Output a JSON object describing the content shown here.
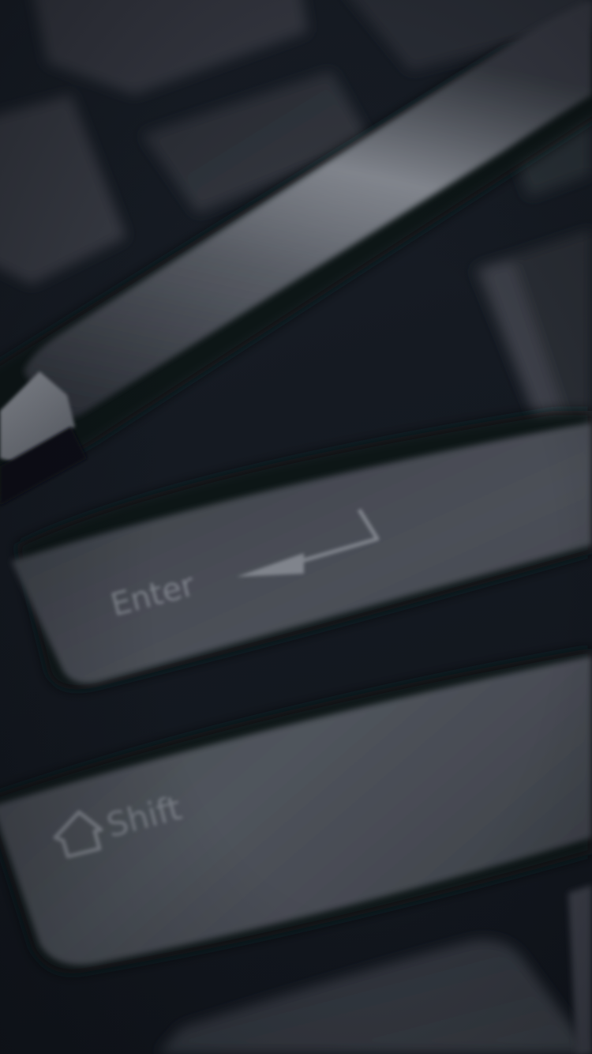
{
  "photo": {
    "subject": "keyboard-with-pen",
    "keys": {
      "enter_label": "Enter",
      "shift_label": "Shift"
    },
    "colors": {
      "background": "#12171f",
      "key_top": "#4a4e56",
      "key_shadow": "#0e1218",
      "pen_body": "#5c6068",
      "pen_highlight": "#9a9ea6",
      "legend": "#7c8088"
    }
  }
}
